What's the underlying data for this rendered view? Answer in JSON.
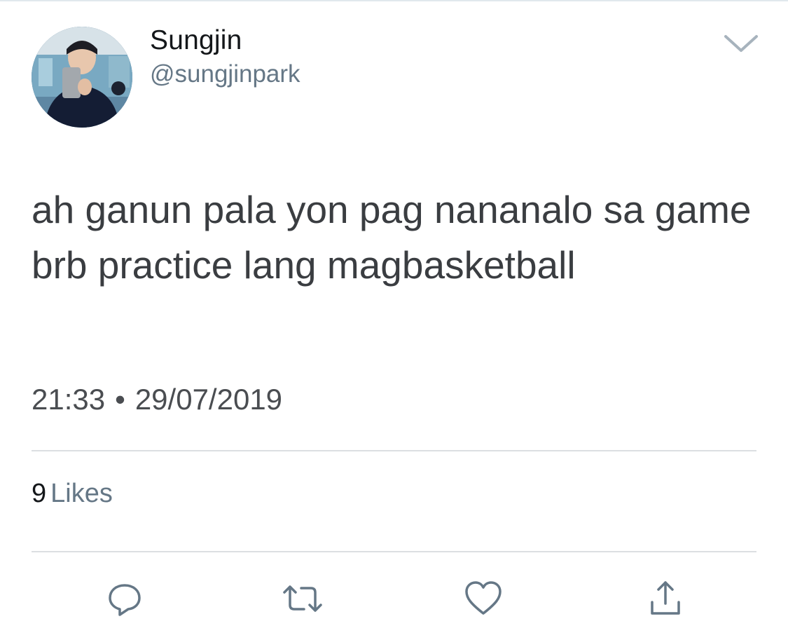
{
  "user": {
    "display_name": "Sungjin",
    "handle": "@sungjinpark"
  },
  "tweet": {
    "text": "ah ganun pala yon pag nananalo sa game brb practice lang magbasketball",
    "time": "21:33",
    "separator": "•",
    "date": "29/07/2019"
  },
  "stats": {
    "likes_count": "9",
    "likes_label": "Likes"
  },
  "icons": {
    "menu": "chevron-down-icon",
    "reply": "reply-icon",
    "retweet": "retweet-icon",
    "like": "heart-icon",
    "share": "share-icon"
  },
  "colors": {
    "icon_gray": "#657786",
    "text_dark": "#14171a",
    "divider": "#dcdfe2"
  }
}
